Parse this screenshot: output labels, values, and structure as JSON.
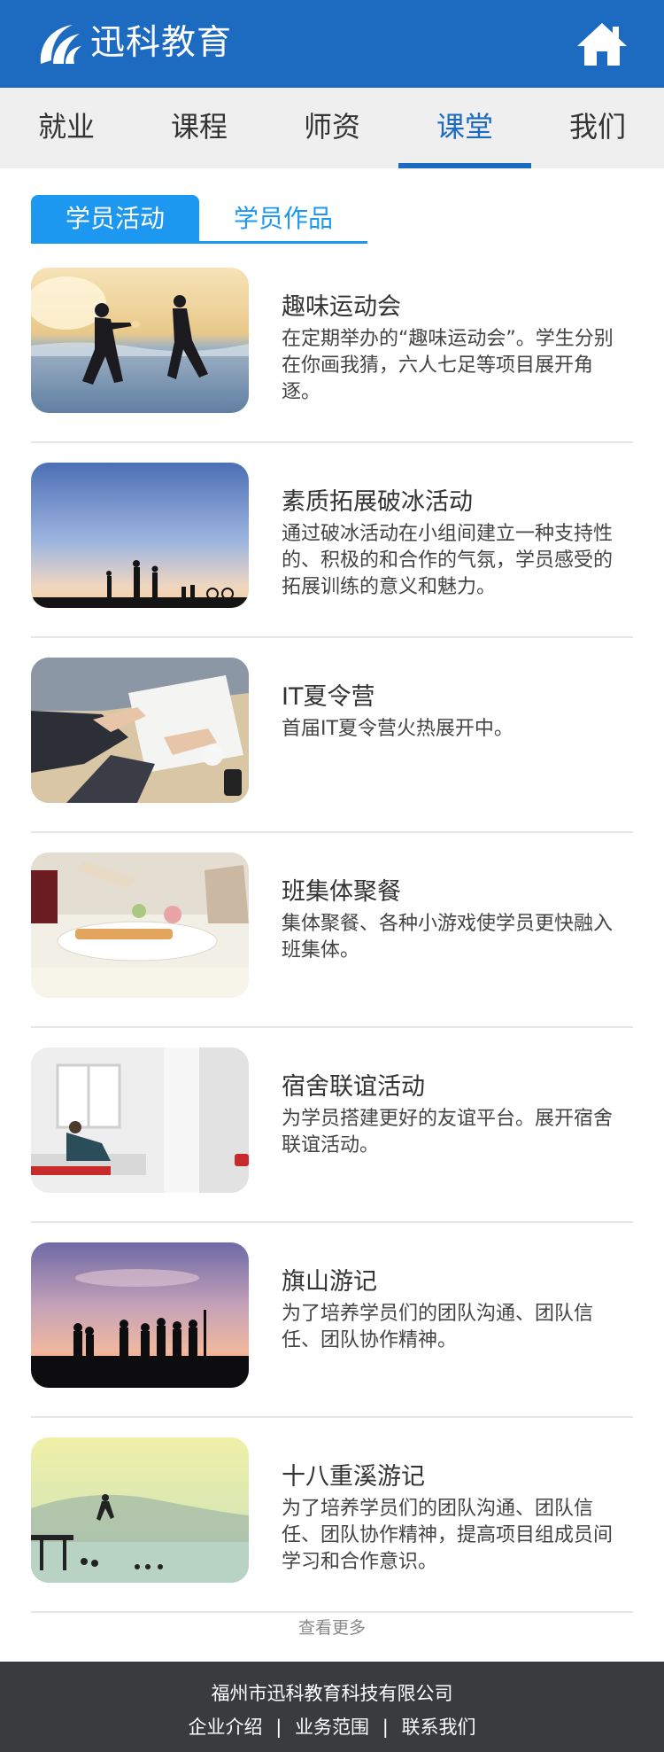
{
  "header": {
    "brand": "迅科教育",
    "logo_icon": "swoosh-logo-icon",
    "home_icon": "home-icon",
    "brand_color": "#1d6bc1"
  },
  "nav": {
    "items": [
      {
        "label": "就业",
        "active": false
      },
      {
        "label": "课程",
        "active": false
      },
      {
        "label": "师资",
        "active": false
      },
      {
        "label": "课堂",
        "active": true
      },
      {
        "label": "我们",
        "active": false
      }
    ]
  },
  "subtabs": {
    "items": [
      {
        "label": "学员活动",
        "active": true
      },
      {
        "label": "学员作品",
        "active": false
      }
    ],
    "accent": "#1d98f1"
  },
  "list": {
    "items": [
      {
        "title": "趣味运动会",
        "desc": "在定期举办的“趣味运动会”。学生分别在你画我猜，六人七足等项目展开角逐。"
      },
      {
        "title": "素质拓展破冰活动",
        "desc": "通过破冰活动在小组间建立一种支持性的、积极的和合作的气氛，学员感受的拓展训练的意义和魅力。"
      },
      {
        "title": "IT夏令营",
        "desc": "首届IT夏令营火热展开中。"
      },
      {
        "title": "班集体聚餐",
        "desc": "集体聚餐、各种小游戏使学员更快融入班集体。"
      },
      {
        "title": "宿舍联谊活动",
        "desc": "为学员搭建更好的友谊平台。展开宿舍联谊活动。"
      },
      {
        "title": "旗山游记",
        "desc": "为了培养学员们的团队沟通、团队信任、团队协作精神。"
      },
      {
        "title": "十八重溪游记",
        "desc": "为了培养学员们的团队沟通、团队信任、团队协作精神，提高项目组成员间学习和合作意识。"
      }
    ]
  },
  "more_label": "查看更多",
  "footer": {
    "company": "福州市迅科教育科技有限公司",
    "links": [
      "企业介绍",
      "业务范围",
      "联系我们"
    ],
    "separator": "|"
  }
}
